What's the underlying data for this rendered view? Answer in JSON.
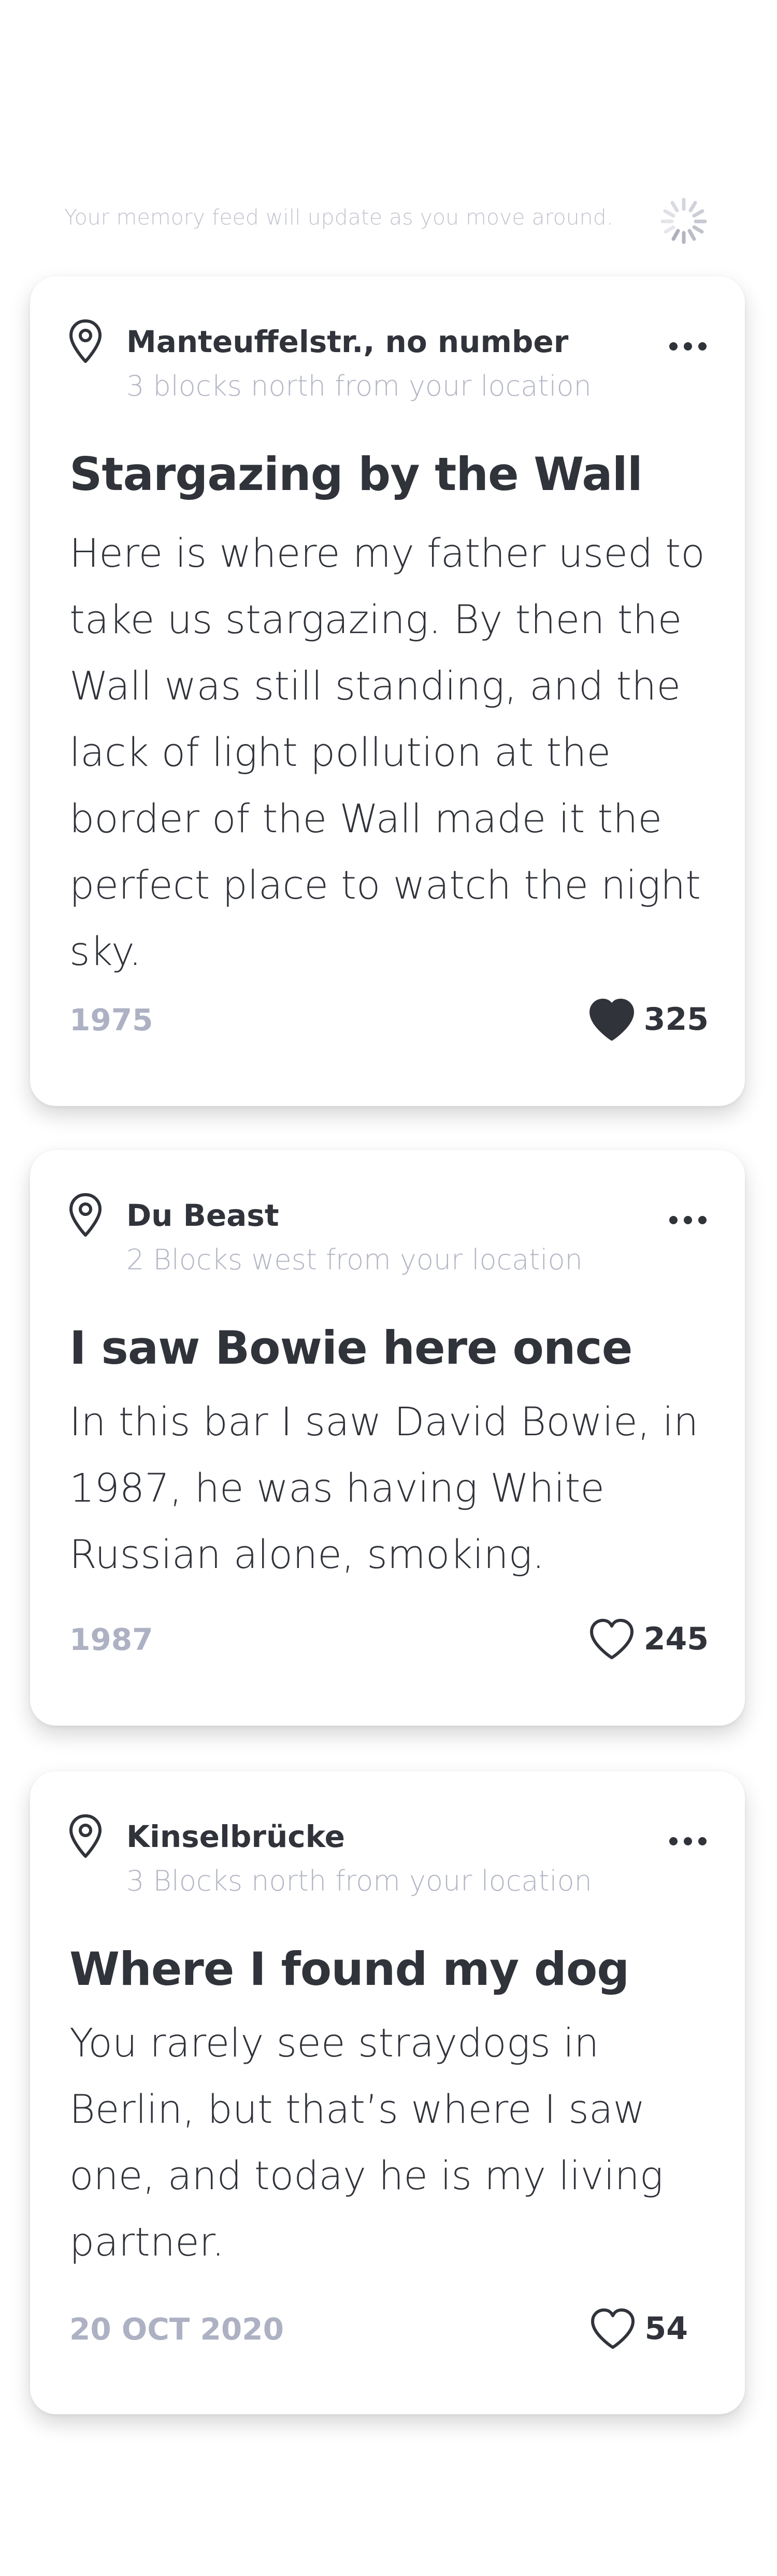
{
  "feed_status": {
    "text": "Your memory feed will update as you move around.",
    "spinner_icon": "loading-spinner-icon"
  },
  "colors": {
    "primary_text": "#30333a",
    "muted_text": "#b4b7c5",
    "date_text": "#adb1c3",
    "card_background": "#ffffff"
  },
  "memories": [
    {
      "location": "Manteuffelstr., no number",
      "distance": "3 blocks north from your location",
      "title": "Stargazing by the Wall",
      "body": "Here is where my father used to take us stargazing. By then the Wall was still standing, and the lack of light pollution at the border of the Wall made it the perfect place to watch the night sky.",
      "date": "1975",
      "likes": "325",
      "liked": true
    },
    {
      "location": "Du Beast",
      "distance": "2 Blocks west from your location",
      "title": "I saw Bowie here once",
      "body": "In this bar I saw David Bowie, in 1987, he was having White Russian alone, smoking.",
      "date": "1987",
      "likes": "245",
      "liked": false
    },
    {
      "location": "Kinselbrücke",
      "distance": "3 Blocks north from your location",
      "title": "Where I found my dog",
      "body": "You rarely see straydogs in Berlin, but that’s where I saw one, and today he is my living partner.",
      "date": "20 OCT 2020",
      "likes": "54",
      "liked": false
    }
  ]
}
